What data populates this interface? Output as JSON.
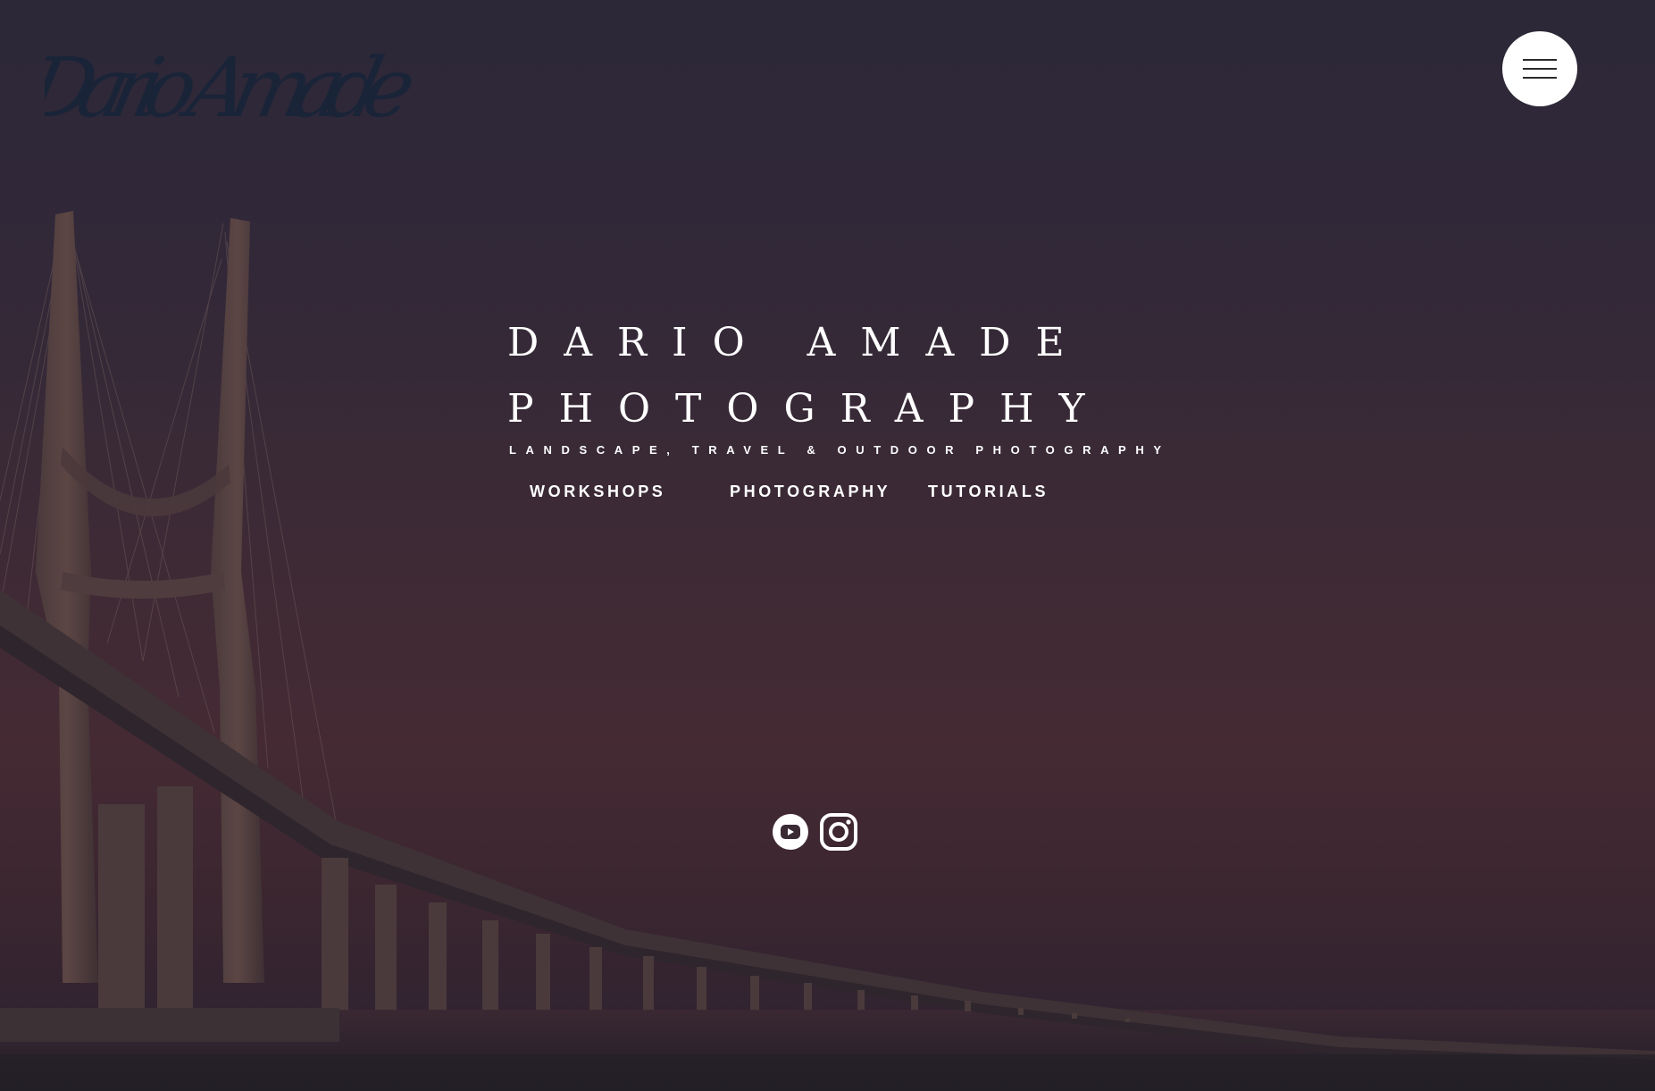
{
  "logo": {
    "text": "Dario Amade",
    "color": "#1a2438"
  },
  "menu": {
    "icon": "hamburger-menu-icon",
    "background": "#ffffff"
  },
  "hero": {
    "line1": "DARIO AMADE",
    "line2": "PHOTOGRAPHY",
    "subtitle": "LANDSCAPE, TRAVEL & OUTDOOR PHOTOGRAPHY"
  },
  "nav": {
    "items": [
      {
        "label": "WORKSHOPS"
      },
      {
        "label": "PHOTOGRAPHY"
      },
      {
        "label": "TUTORIALS"
      }
    ]
  },
  "social": {
    "items": [
      {
        "icon": "youtube-icon"
      },
      {
        "icon": "instagram-icon"
      }
    ]
  },
  "colors": {
    "text": "#ffffff",
    "sky_top": "#2c2838",
    "sky_bottom": "#452a33"
  }
}
